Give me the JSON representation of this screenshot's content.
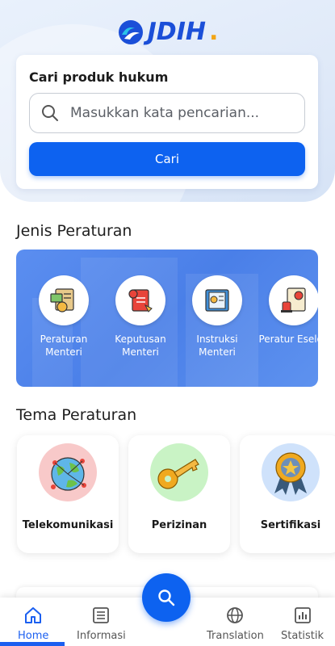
{
  "header": {
    "logo_text": "JDIH",
    "logo_dot": "."
  },
  "search": {
    "title": "Cari produk hukum",
    "placeholder": "Masukkan kata pencarian...",
    "button_label": "Cari"
  },
  "jenis": {
    "title": "Jenis Peraturan",
    "items": [
      {
        "label": "Peraturan Menteri",
        "icon": "document-stamp-icon"
      },
      {
        "label": "Keputusan Menteri",
        "icon": "red-document-icon"
      },
      {
        "label": "Instruksi Menteri",
        "icon": "instruction-book-icon"
      },
      {
        "label": "Peratur Eselon",
        "icon": "certificate-stamp-icon"
      }
    ]
  },
  "tema": {
    "title": "Tema Peraturan",
    "items": [
      {
        "label": "Telekomunikasi",
        "icon": "globe-network-icon",
        "bg": "#f8c9c9"
      },
      {
        "label": "Perizinan",
        "icon": "key-icon",
        "bg": "#c9f3c5"
      },
      {
        "label": "Sertifikasi",
        "icon": "medal-icon",
        "bg": "#cfe2fb"
      }
    ]
  },
  "nav": {
    "items": [
      {
        "label": "Home",
        "icon": "home-icon",
        "active": true
      },
      {
        "label": "Informasi",
        "icon": "list-icon",
        "active": false
      },
      {
        "label": "Translation",
        "icon": "globe-icon",
        "active": false
      },
      {
        "label": "Statistik",
        "icon": "chart-icon",
        "active": false
      }
    ],
    "fab_icon": "search-icon"
  },
  "colors": {
    "primary": "#0d62f0",
    "panel": "#4f84ec",
    "accent": "#f2a516"
  }
}
